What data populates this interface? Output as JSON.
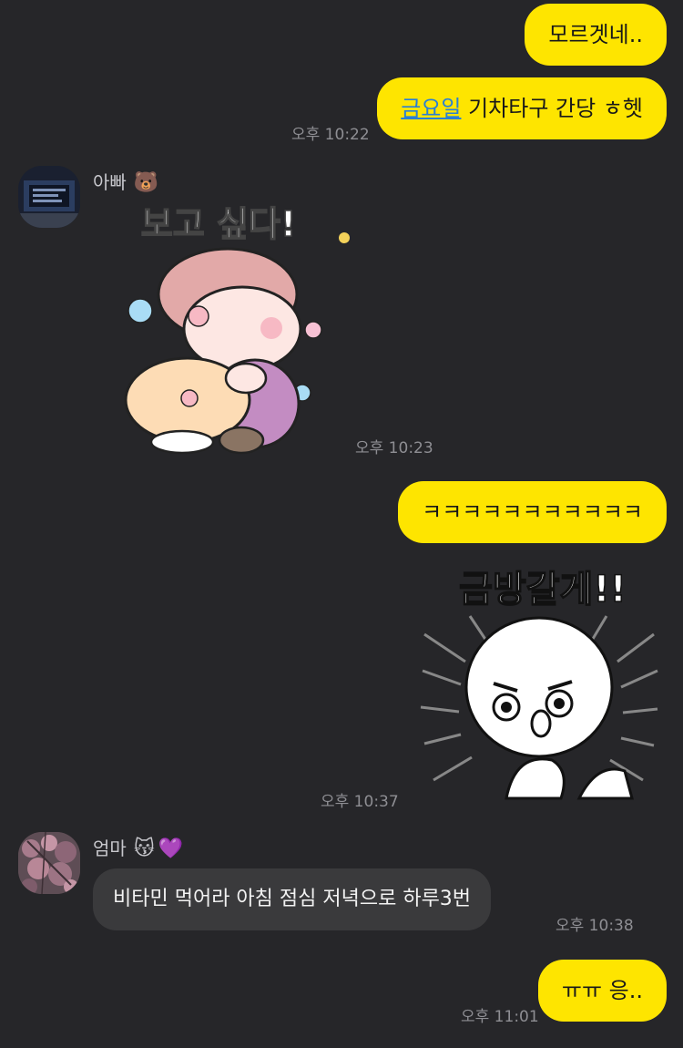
{
  "messages": {
    "m1": {
      "text": "모르겟네.."
    },
    "m2": {
      "link": "금요일",
      "rest": " 기차타구 간당 ㅎ헷",
      "time": "오후 10:22"
    },
    "dad": {
      "name": "아빠",
      "emoji": "🐻",
      "sticker_text": "보고 싶다!",
      "time": "오후 10:23"
    },
    "m3": {
      "text": "ㅋㅋㅋㅋㅋㅋㅋㅋㅋㅋㅋ"
    },
    "m4": {
      "sticker_text": "금방갈게!!",
      "time": "오후 10:37"
    },
    "mom": {
      "name": "엄마",
      "emoji1": "😽",
      "emoji2": "💜",
      "text": "비타민 먹어라 아침  점심  저녁으로  하루3번",
      "time": "오후 10:38"
    },
    "m5": {
      "text": "ㅠㅠ 응..",
      "time": "오후 11:01"
    }
  },
  "colors": {
    "background": "#262629",
    "my_bubble": "#fee500",
    "other_bubble": "#3a3a3c"
  }
}
